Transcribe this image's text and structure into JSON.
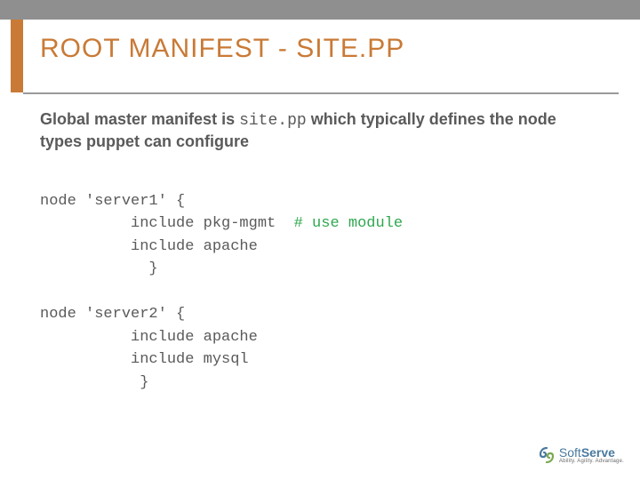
{
  "title": "ROOT MANIFEST - SITE.PP",
  "subtitle_pre": "Global master manifest is ",
  "subtitle_code": "site.pp",
  "subtitle_post": " which typically defines the node types puppet can configure",
  "code": {
    "l1": "node 'server1' {",
    "l2": "          include pkg-mgmt  ",
    "l2_comment": "# use module",
    "l3": "          include apache",
    "l4": "            }",
    "l5": "",
    "l6": "node 'server2' {",
    "l7": "          include apache",
    "l8": "          include mysql",
    "l9": "           }"
  },
  "logo": {
    "name_soft": "Soft",
    "name_bold": "Serve",
    "tagline": "Ability. Agility. Advantage."
  }
}
